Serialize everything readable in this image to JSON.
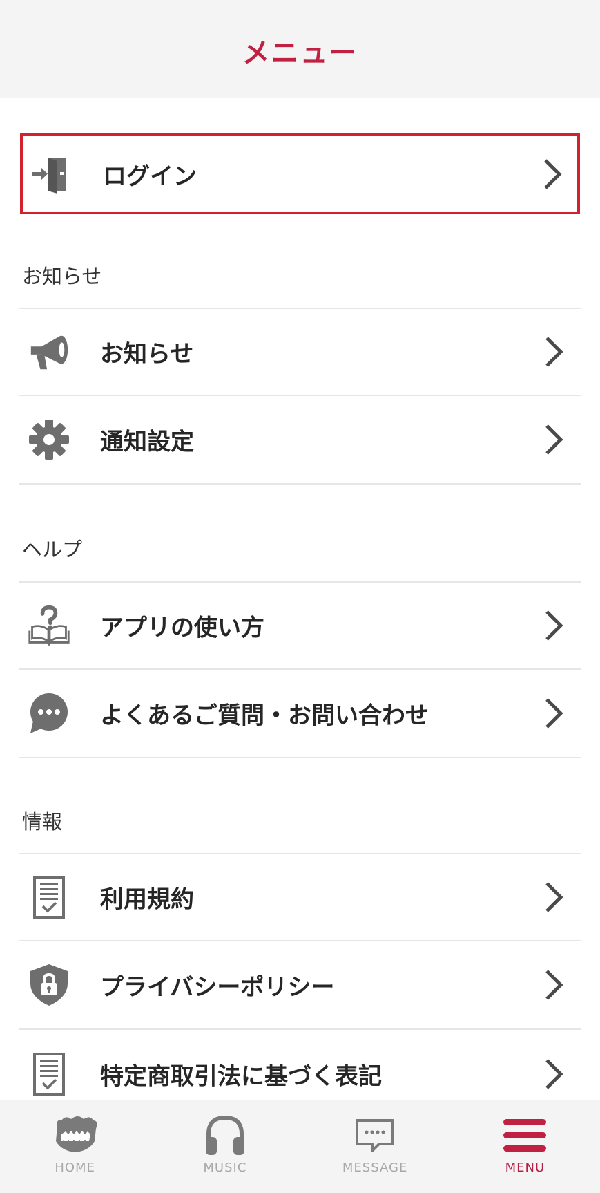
{
  "header": {
    "title": "メニュー"
  },
  "login": {
    "label": "ログイン",
    "icon": "login-door-icon"
  },
  "sections": {
    "news": {
      "title": "お知らせ",
      "items": [
        {
          "label": "お知らせ",
          "icon": "megaphone-icon"
        },
        {
          "label": "通知設定",
          "icon": "gear-icon"
        }
      ]
    },
    "help": {
      "title": "ヘルプ",
      "items": [
        {
          "label": "アプリの使い方",
          "icon": "book-question-icon"
        },
        {
          "label": "よくあるご質問・お問い合わせ",
          "icon": "chat-bubble-icon"
        }
      ]
    },
    "info": {
      "title": "情報",
      "items": [
        {
          "label": "利用規約",
          "icon": "document-check-icon"
        },
        {
          "label": "プライバシーポリシー",
          "icon": "shield-lock-icon"
        },
        {
          "label": "特定商取引法に基づく表記",
          "icon": "document-check-icon"
        }
      ]
    }
  },
  "tabbar": {
    "tabs": [
      {
        "label": "HOME",
        "icon": "home-mascot-icon",
        "active": false
      },
      {
        "label": "MUSIC",
        "icon": "headphones-icon",
        "active": false
      },
      {
        "label": "MESSAGE",
        "icon": "message-icon",
        "active": false
      },
      {
        "label": "MENU",
        "icon": "hamburger-menu-icon",
        "active": true
      }
    ]
  },
  "colors": {
    "accent": "#c02143",
    "icon_gray": "#6e6e6e",
    "chevron": "#4a4a4a",
    "login_border": "#d1222d"
  }
}
